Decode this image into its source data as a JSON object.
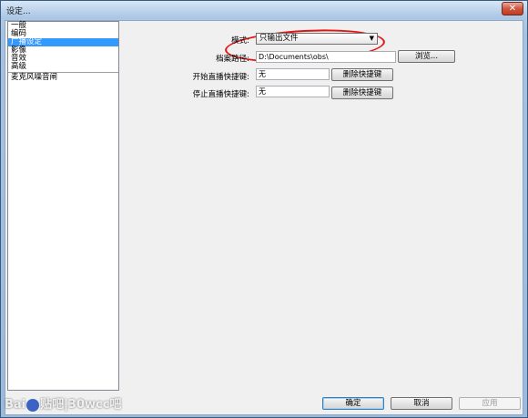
{
  "window": {
    "title": "设定...",
    "close_glyph": "✕"
  },
  "sidebar": {
    "items": [
      {
        "label": "一般",
        "selected": false
      },
      {
        "label": "编码",
        "selected": false
      },
      {
        "label": "广播设定",
        "selected": true
      },
      {
        "label": "影像",
        "selected": false
      },
      {
        "label": "音效",
        "selected": false
      },
      {
        "label": "高级",
        "selected": false
      },
      {
        "label": "麦克风噪音闸",
        "selected": false
      }
    ]
  },
  "form": {
    "mode_label": "模式:",
    "mode_value": "只输出文件",
    "path_label": "档案路径:",
    "path_value": "D:\\Documents\\obs\\",
    "browse_label": "浏览...",
    "start_hotkey_label": "开始直播快捷键:",
    "start_hotkey_value": "无",
    "start_clear_label": "删除快捷键",
    "stop_hotkey_label": "停止直播快捷键:",
    "stop_hotkey_value": "无",
    "stop_clear_label": "删除快捷键"
  },
  "footer": {
    "ok_label": "确定",
    "cancel_label": "取消",
    "apply_label": "应用"
  },
  "watermark": {
    "prefix": "Bai",
    "suffix": "贴吧",
    "extra": "|30wcc吧"
  },
  "colors": {
    "selection": "#3399ff",
    "annotation": "#e01515"
  }
}
